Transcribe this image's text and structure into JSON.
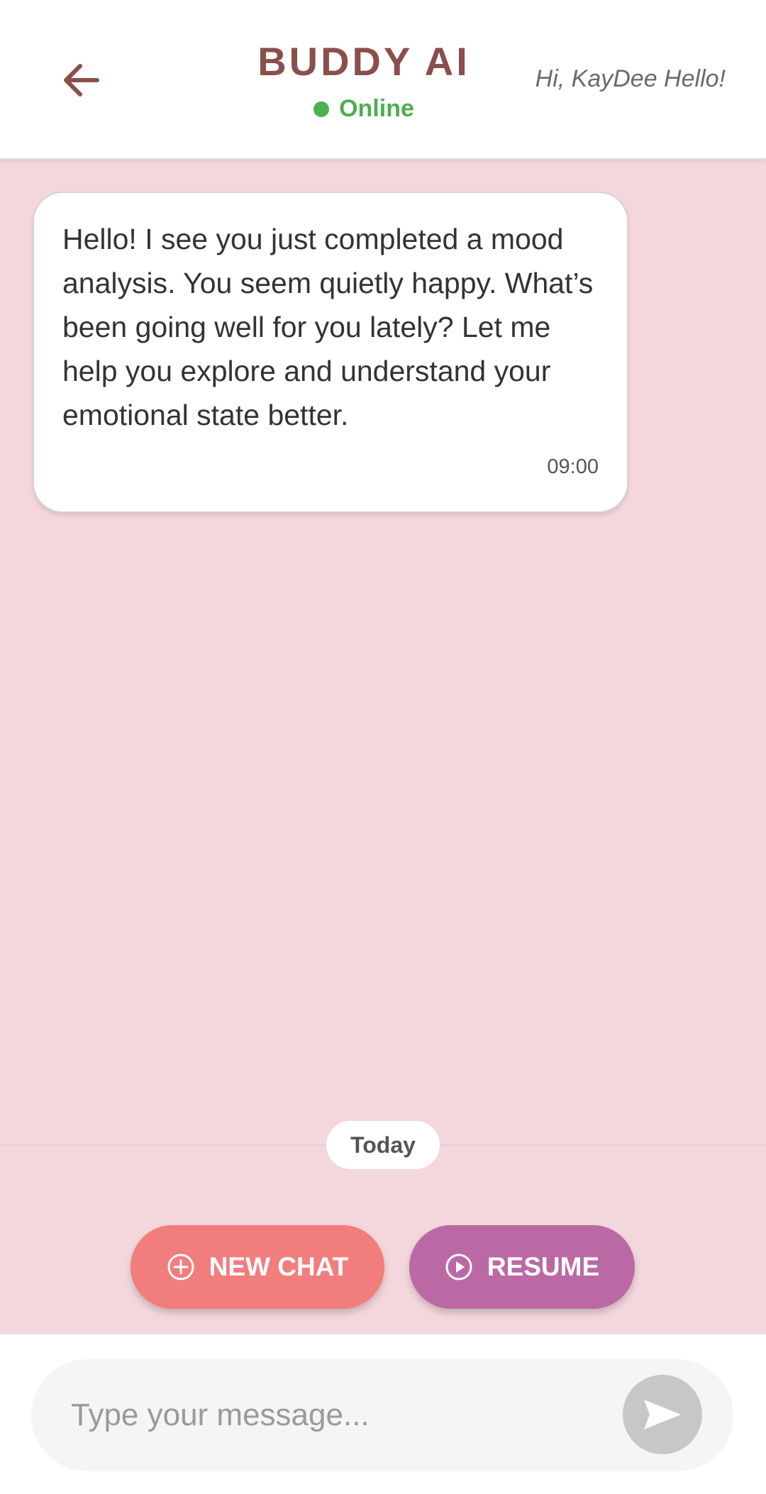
{
  "header": {
    "title": "BUDDY AI",
    "status": "Online",
    "greeting": "Hi, KayDee Hello!"
  },
  "chat": {
    "messages": [
      {
        "text": "Hello! I see you just completed a mood analysis. You seem quietly happy. What’s been going well for you lately? Let me help you explore and understand your emotional state better.",
        "time": "09:00"
      }
    ],
    "date_label": "Today"
  },
  "actions": {
    "new_chat_label": "NEW CHAT",
    "resume_label": "RESUME"
  },
  "composer": {
    "placeholder": "Type your message..."
  },
  "icons": {
    "back": "arrow-left-icon",
    "status": "online-dot-icon",
    "new_chat": "plus-circle-icon",
    "resume": "play-circle-icon",
    "send": "send-icon"
  },
  "colors": {
    "title": "#8a4f4d",
    "online": "#4caf50",
    "background": "#f4d7dc",
    "new_chat": "#f27d7d",
    "resume": "#bb69a5",
    "send_disabled": "#c7c7c7"
  }
}
